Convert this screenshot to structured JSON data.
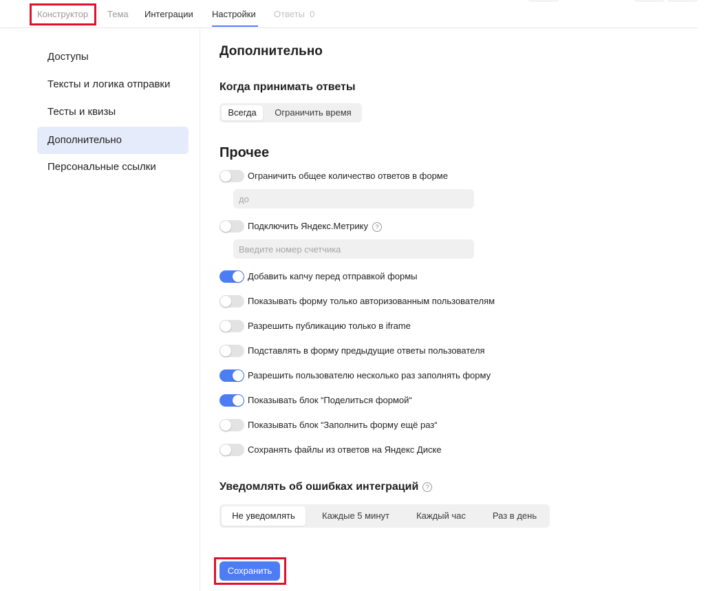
{
  "tabs": [
    {
      "label": "Конструктор"
    },
    {
      "label": "Тема"
    },
    {
      "label": "Интеграции"
    },
    {
      "label": "Настройки"
    },
    {
      "label": "Ответы",
      "count": "0"
    }
  ],
  "sidebar": {
    "items": [
      {
        "label": "Доступы"
      },
      {
        "label": "Тексты и логика отправки"
      },
      {
        "label": "Тесты и квизы"
      },
      {
        "label": "Дополнительно",
        "active": true
      },
      {
        "label": "Персональные ссылки"
      }
    ]
  },
  "main": {
    "title": "Дополнительно",
    "accept": {
      "heading": "Когда принимать ответы",
      "options": [
        "Всегда",
        "Ограничить время"
      ],
      "selected": "Всегда"
    },
    "other": {
      "heading": "Прочее",
      "limit": {
        "label": "Ограничить общее количество ответов в форме",
        "on": false,
        "placeholder": "до"
      },
      "metrika": {
        "label": "Подключить Яндекс.Метрику",
        "on": false,
        "placeholder": "Введите номер счетчика",
        "help_icon": "?"
      },
      "toggles": [
        {
          "label": "Добавить капчу перед отправкой формы",
          "on": true
        },
        {
          "label": "Показывать форму только авторизованным пользователям",
          "on": false
        },
        {
          "label": "Разрешить публикацию только в iframe",
          "on": false
        },
        {
          "label": "Подставлять в форму предыдущие ответы пользователя",
          "on": false
        },
        {
          "label": "Разрешить пользователю несколько раз заполнять форму",
          "on": true
        },
        {
          "label": "Показывать блок “Поделиться формой“",
          "on": true
        },
        {
          "label": "Показывать блок “Заполнить форму ещё раз“",
          "on": false
        },
        {
          "label": "Сохранять файлы из ответов на Яндекс Диске",
          "on": false
        }
      ]
    },
    "notify": {
      "heading": "Уведомлять об ошибках интеграций",
      "help_icon": "?",
      "options": [
        "Не уведомлять",
        "Каждые 5 минут",
        "Каждый час",
        "Раз в день"
      ],
      "selected": "Не уведомлять"
    },
    "save_label": "Сохранить"
  },
  "colors": {
    "accent": "#4d7df5",
    "highlight": "#e0102b",
    "active_side": "#e6ebfb",
    "toggle_off": "#e3e3e3"
  }
}
